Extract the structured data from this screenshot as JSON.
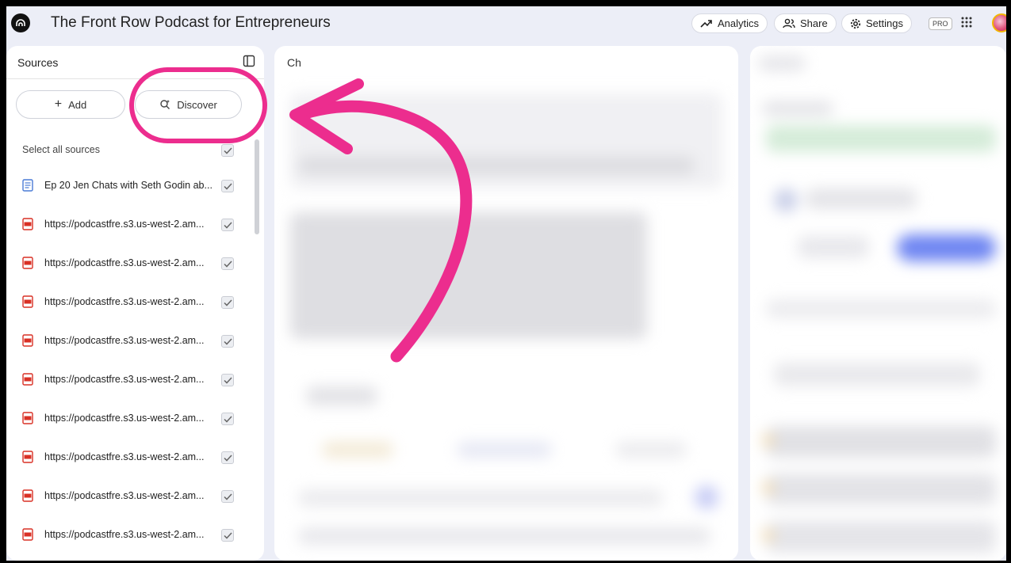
{
  "app": {
    "title": "The Front Row Podcast for Entrepreneurs",
    "logo_icon": "notebook-logo-icon"
  },
  "topbar": {
    "analytics_label": "Analytics",
    "share_label": "Share",
    "settings_label": "Settings",
    "pro_badge": "PRO"
  },
  "sources": {
    "title": "Sources",
    "add_label": "Add",
    "discover_label": "Discover",
    "select_all_label": "Select all sources",
    "items": [
      {
        "label": "Ep 20 Jen Chats with Seth Godin ab...",
        "type": "doc"
      },
      {
        "label": "https://podcastfre.s3.us-west-2.am...",
        "type": "pdf"
      },
      {
        "label": "https://podcastfre.s3.us-west-2.am...",
        "type": "pdf"
      },
      {
        "label": "https://podcastfre.s3.us-west-2.am...",
        "type": "pdf"
      },
      {
        "label": "https://podcastfre.s3.us-west-2.am...",
        "type": "pdf"
      },
      {
        "label": "https://podcastfre.s3.us-west-2.am...",
        "type": "pdf"
      },
      {
        "label": "https://podcastfre.s3.us-west-2.am...",
        "type": "pdf"
      },
      {
        "label": "https://podcastfre.s3.us-west-2.am...",
        "type": "pdf"
      },
      {
        "label": "https://podcastfre.s3.us-west-2.am...",
        "type": "pdf"
      },
      {
        "label": "https://podcastfre.s3.us-west-2.am...",
        "type": "pdf"
      }
    ]
  },
  "chat": {
    "title_partial": "Ch"
  },
  "colors": {
    "highlight": "#ec2d8e",
    "pdf_red": "#d93025",
    "doc_blue": "#4a7bd6"
  }
}
